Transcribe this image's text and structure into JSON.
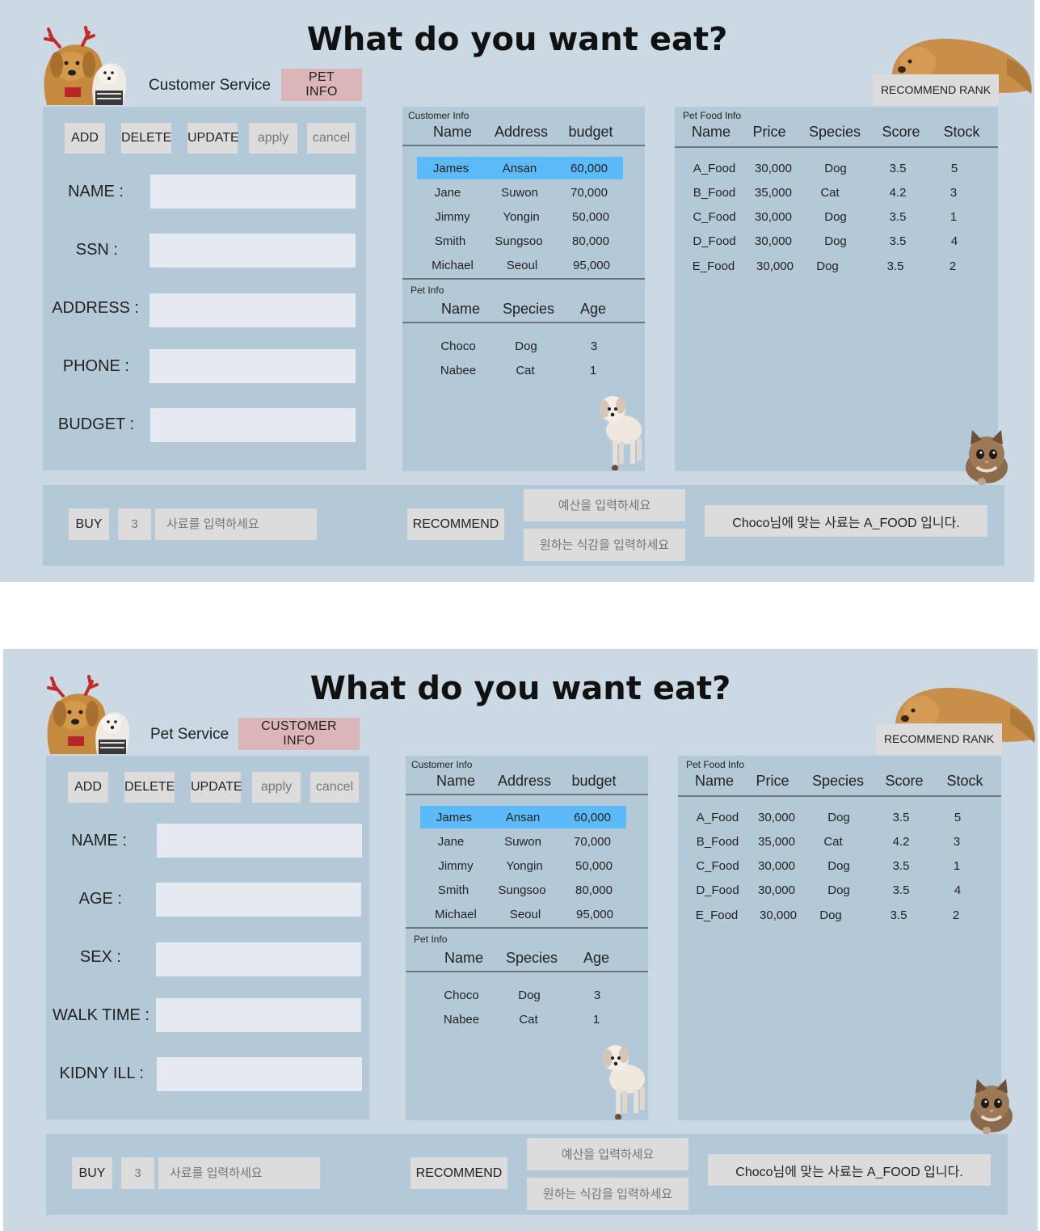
{
  "colors": {
    "background": "#cad9e3",
    "panel": "#b4c9d8",
    "switch_button": "#dcb5b8",
    "selected_row": "#5bbbf8",
    "button": "#dcdcdc",
    "input": "#e4eaf0"
  },
  "screens": [
    {
      "title": "What do you want eat?",
      "service_label": "Customer Service",
      "switch_button": "PET INFO",
      "rank_button": "RECOMMEND RANK",
      "toolbar": {
        "add": "ADD",
        "delete": "DELETE",
        "update": "UPDATE",
        "apply": "apply",
        "cancel": "cancel"
      },
      "fields": [
        "NAME :",
        "SSN :",
        "ADDRESS :",
        "PHONE :",
        "BUDGET :"
      ]
    },
    {
      "title": "What do you want eat?",
      "service_label": "Pet Service",
      "switch_button": "CUSTOMER INFO",
      "rank_button": "RECOMMEND RANK",
      "toolbar": {
        "add": "ADD",
        "delete": "DELETE",
        "update": "UPDATE",
        "apply": "apply",
        "cancel": "cancel"
      },
      "fields": [
        "NAME :",
        "AGE :",
        "SEX :",
        "WALK TIME :",
        "KIDNY ILL :"
      ]
    }
  ],
  "customer_info": {
    "caption": "Customer Info",
    "headers": [
      "Name",
      "Address",
      "budget"
    ],
    "rows": [
      [
        "James",
        "Ansan",
        "60,000"
      ],
      [
        "Jane",
        "Suwon",
        "70,000"
      ],
      [
        "Jimmy",
        "Yongin",
        "50,000"
      ],
      [
        "Smith",
        "Sungsoo",
        "80,000"
      ],
      [
        "Michael",
        "Seoul",
        "95,000"
      ]
    ]
  },
  "pet_info": {
    "caption": "Pet Info",
    "headers": [
      "Name",
      "Species",
      "Age"
    ],
    "rows": [
      [
        "Choco",
        "Dog",
        "3"
      ],
      [
        "Nabee",
        "Cat",
        "1"
      ]
    ]
  },
  "pet_food_info": {
    "caption": "Pet Food Info",
    "headers": [
      "Name",
      "Price",
      "Species",
      "Score",
      "Stock"
    ],
    "rows": [
      [
        "A_Food",
        "30,000",
        "Dog",
        "3.5",
        "5"
      ],
      [
        "B_Food",
        "35,000",
        "Cat",
        "4.2",
        "3"
      ],
      [
        "C_Food",
        "30,000",
        "Dog",
        "3.5",
        "1"
      ],
      [
        "D_Food",
        "30,000",
        "Dog",
        "3.5",
        "4"
      ],
      [
        "E_Food",
        "30,000",
        "Dog",
        "3.5",
        "2"
      ]
    ]
  },
  "bottom": {
    "buy": "BUY",
    "quantity": "3",
    "food_placeholder": "사료를 입력하세요",
    "recommend": "RECOMMEND",
    "budget_placeholder": "예산을 입력하세요",
    "texture_placeholder": "원하는 식감을 입력하세요",
    "result": "Choco님에 맞는 사료는 A_FOOD  입니다."
  }
}
